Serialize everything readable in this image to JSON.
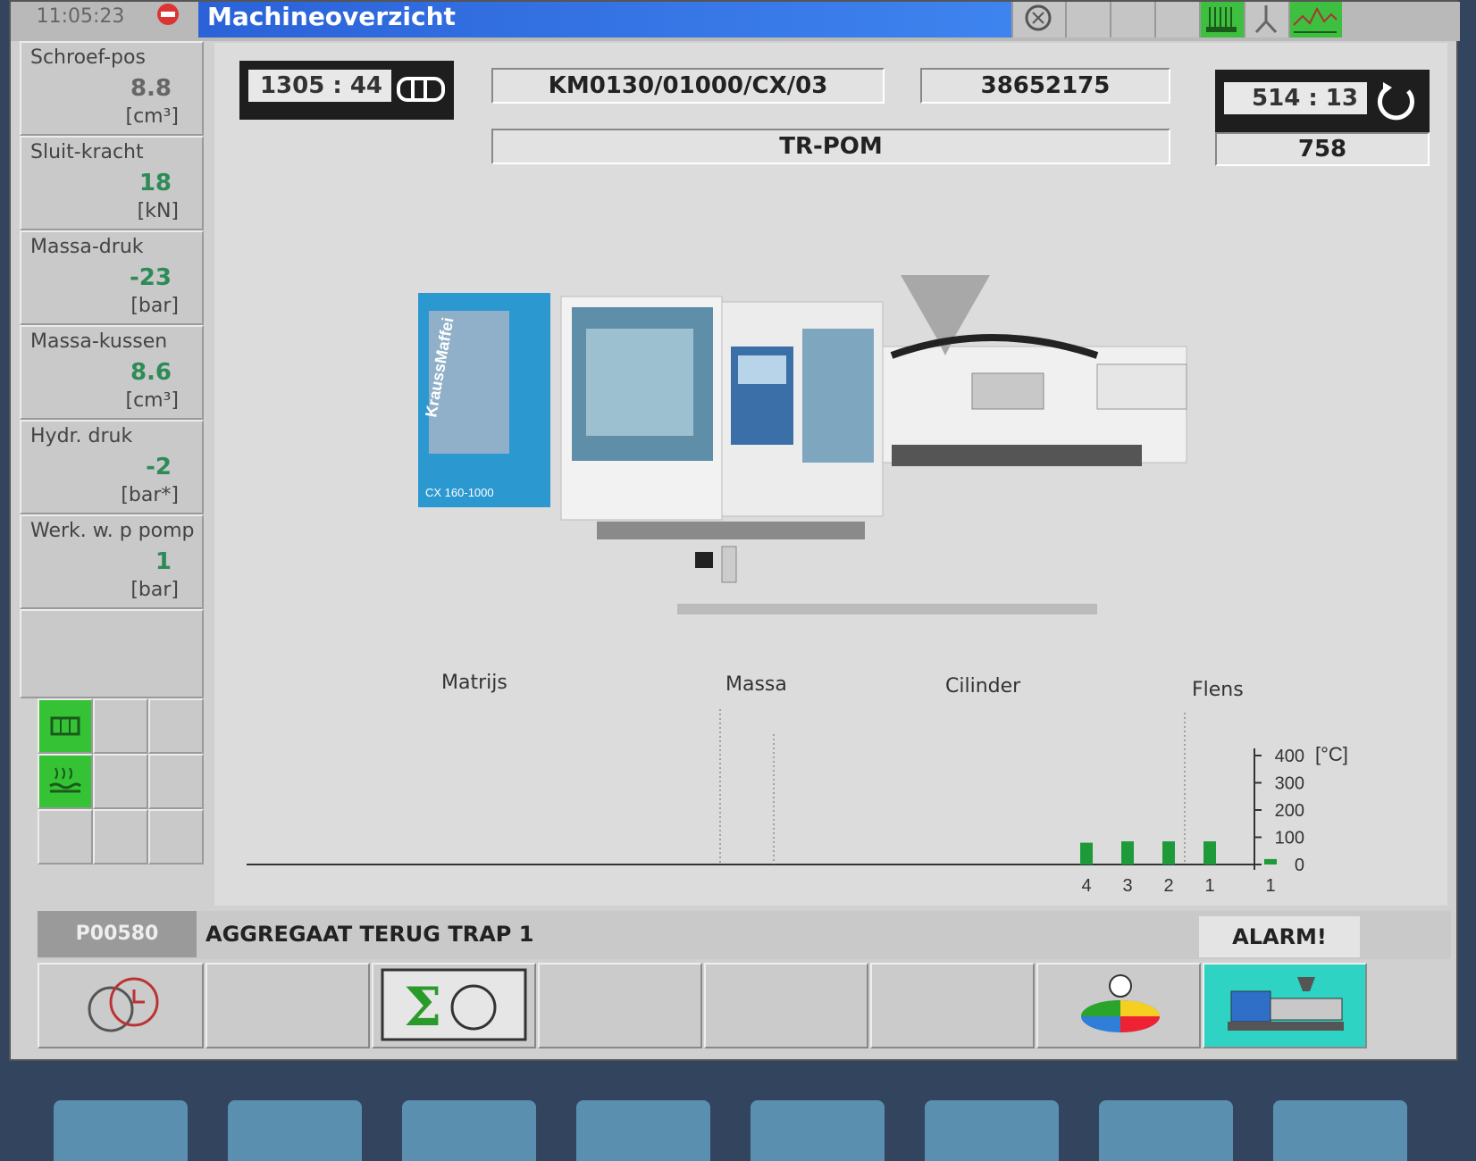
{
  "header": {
    "time": "11:05:23",
    "title": "Machineoverzicht"
  },
  "sidebar": {
    "params": [
      {
        "label": "Schroef-pos",
        "value": "8.8",
        "unit": "[cm³]"
      },
      {
        "label": "Sluit-kracht",
        "value": "18",
        "unit": "[kN]"
      },
      {
        "label": "Massa-druk",
        "value": "-23",
        "unit": "[bar]"
      },
      {
        "label": "Massa-kussen",
        "value": "8.6",
        "unit": "[cm³]"
      },
      {
        "label": "Hydr. druk",
        "value": "-2",
        "unit": "[bar*]"
      },
      {
        "label": "Werk. w. p pomp",
        "value": "1",
        "unit": "[bar]"
      }
    ]
  },
  "main": {
    "cycle_counter": "1305 : 44",
    "order_code": "KM0130/01000/CX/03",
    "order_number": "38652175",
    "material": "TR-POM",
    "time_counter": "514 : 13",
    "count": "758",
    "machine_brand": "KraussMaffei",
    "machine_model": "CX 160-1000"
  },
  "chart_data": {
    "type": "bar",
    "sections": [
      "Matrijs",
      "Massa",
      "Cilinder",
      "Flens"
    ],
    "categories": [
      "4",
      "3",
      "2",
      "1",
      "1"
    ],
    "values": [
      80,
      85,
      85,
      85,
      20
    ],
    "unit": "[°C]",
    "yticks": [
      "400",
      "300",
      "200",
      "100",
      "0"
    ],
    "ylim": [
      0,
      400
    ]
  },
  "status": {
    "code": "P00580",
    "message": "AGGREGAAT TERUG TRAP 1",
    "alarm": "ALARM!"
  },
  "colors": {
    "title_blue": "#2b62d8",
    "value_green": "#2e8b57",
    "active_green": "#35c235",
    "teal": "#2fd3c3"
  }
}
